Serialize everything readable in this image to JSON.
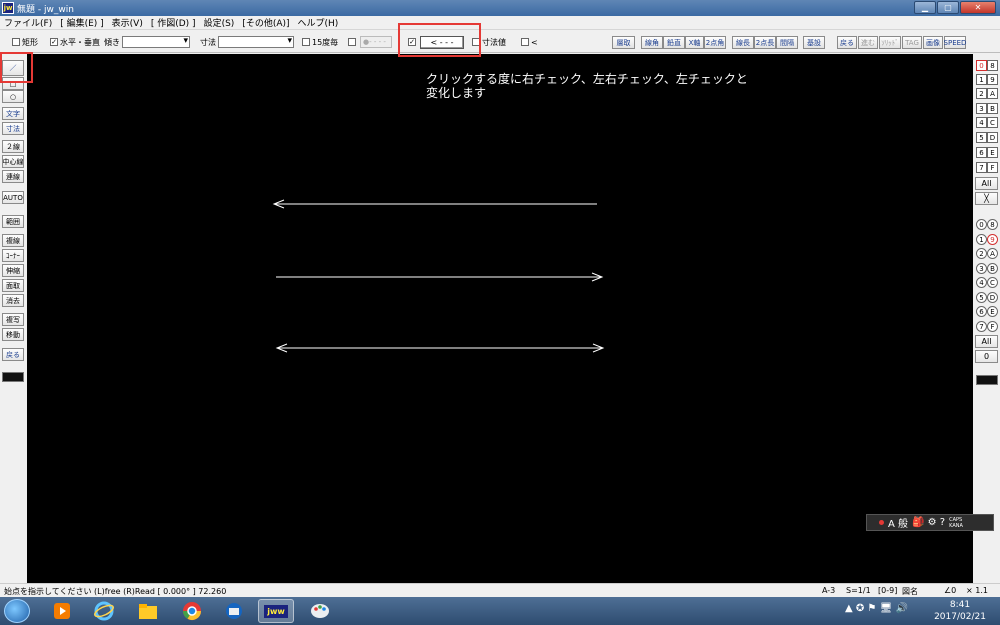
{
  "window": {
    "app_icon": "jw",
    "title": "無題 - jw_win",
    "min": "▁",
    "max": "▢",
    "close": "✕"
  },
  "menu": [
    "ファイル(F)",
    "[ 編集(E) ]",
    "表示(V)",
    "[ 作図(D) ]",
    "設定(S)",
    "[その他(A)]",
    "ヘルプ(H)"
  ],
  "toolbar": {
    "rect_label": "矩形",
    "hv_label": "水平・垂直",
    "angle_label": "傾き",
    "dim_label": "寸法",
    "deg15_label": "15度毎",
    "dot_label": "●- - - -",
    "arrow_btn": "< - - -",
    "dimval_label": "寸法値",
    "lt_label": "<",
    "checked_mark": "✓",
    "right_tools": [
      "層取",
      "線角",
      "鉛直",
      "X軸",
      "2点角",
      "線長",
      "2点長",
      "間隔",
      "基設",
      "戻る",
      "進む",
      "ｿﾘｯﾄﾞ",
      "TAG",
      "画像",
      "SPEED"
    ]
  },
  "canvas": {
    "note_line1": "クリックする度に右チェック、左右チェック、左チェックと",
    "note_line2": "変化します"
  },
  "left_tools": [
    "／",
    "□",
    "○",
    "文字",
    "寸法",
    "２線",
    "中心線",
    "連線",
    "AUTO",
    "範囲",
    "複線",
    "ｺｰﾅｰ",
    "伸縮",
    "面取",
    "消去",
    "複写",
    "移動",
    "戻る"
  ],
  "right_layers": {
    "top_rows": [
      [
        "0",
        "8"
      ],
      [
        "1",
        "9"
      ],
      [
        "2",
        "A"
      ],
      [
        "3",
        "B"
      ],
      [
        "4",
        "C"
      ],
      [
        "5",
        "D"
      ],
      [
        "6",
        "E"
      ],
      [
        "7",
        "F"
      ]
    ],
    "all_label": "All",
    "x_label": "╳",
    "bottom_rows": [
      [
        "0",
        "8"
      ],
      [
        "1",
        "9"
      ],
      [
        "2",
        "A"
      ],
      [
        "3",
        "B"
      ],
      [
        "4",
        "C"
      ],
      [
        "5",
        "D"
      ],
      [
        "6",
        "E"
      ],
      [
        "7",
        "F"
      ]
    ],
    "all2_label": "All",
    "zero_label": "0"
  },
  "ime": {
    "mode": "A 般",
    "icons": "🎒 ⚙ ?",
    "caps": "CAPS",
    "kana": "KANA"
  },
  "status": {
    "message": "始点を指示してください (L)free (R)Read [ 0.000° ] 72.260",
    "paper": "A-3",
    "scale": "S=1/1",
    "layer": "[0-9]",
    "layer_name": "図名",
    "angle": "∠0",
    "zoom": "× 1.1"
  },
  "taskbar": {
    "tray_icons": "▲ ✪ ⚑ 🖥 🔊",
    "time": "8:41",
    "date": "2017/02/21",
    "app_jw": "jww"
  }
}
